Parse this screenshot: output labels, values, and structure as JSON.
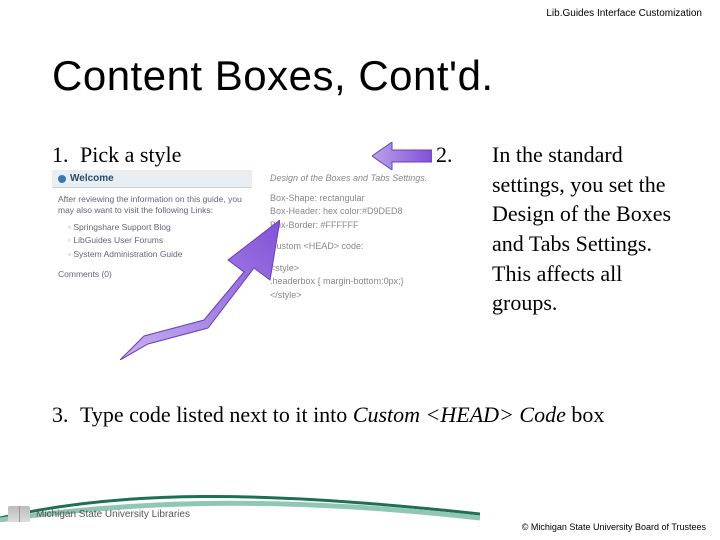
{
  "header_label": "Lib.Guides Interface Customization",
  "title": "Content Boxes, Cont'd.",
  "step1": {
    "marker": "1.",
    "text": "Pick a style"
  },
  "step2": {
    "marker": "2.",
    "text": "In the standard settings, you set the Design of the Boxes and Tabs Settings. This affects all groups."
  },
  "step3": {
    "marker": "3.",
    "prefix": "Type code listed next to it into ",
    "italic1": "Custom <HEAD> Code",
    "suffix": " box"
  },
  "screenshot": {
    "panel_title": "Welcome",
    "panel_intro": "After reviewing the information on this guide, you may also want to visit the following Links:",
    "links": [
      "Springshare Support Blog",
      "LibGuides User Forums",
      "System Administration Guide"
    ],
    "comments": "Comments (0)",
    "design_heading": "Design of the Boxes and Tabs Settings.",
    "box_shape": "Box-Shape: rectangular",
    "box_header": "Box-Header: hex color:#D9DED8",
    "box_border": "Box-Border: #FFFFFF",
    "custom_head_label": "Custom <HEAD> code:",
    "code_open": "<style>",
    "code_rule": ".headerbox {  margin-bottom:0px;}",
    "code_close": "</style>"
  },
  "footer": {
    "org": "Michigan State University Libraries",
    "copyright": "© Michigan State University Board of Trustees"
  }
}
